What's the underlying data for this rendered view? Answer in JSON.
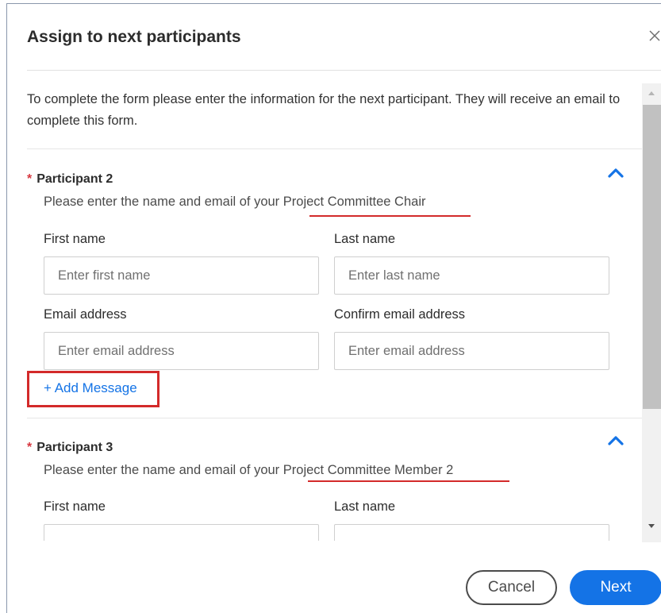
{
  "dialog": {
    "title": "Assign to next participants",
    "close_icon": "close-icon",
    "intro": "To complete the form please enter the information for the next participant. They will receive an email to complete this form."
  },
  "participants": [
    {
      "title": "Participant 2",
      "desc_prefix": "Please enter the name and email of your ",
      "role": "Project Committee Chair",
      "first_name_label": "First name",
      "first_name_placeholder": "Enter first name",
      "last_name_label": "Last name",
      "last_name_placeholder": "Enter last name",
      "email_label": "Email address",
      "email_placeholder": "Enter email address",
      "confirm_email_label": "Confirm email address",
      "confirm_email_placeholder": "Enter email address",
      "add_message": "+ Add Message"
    },
    {
      "title": "Participant 3",
      "desc_prefix": "Please enter the name and email of your ",
      "role": "Project Committee Member 2",
      "first_name_label": "First name",
      "last_name_label": "Last name"
    }
  ],
  "footer": {
    "cancel_label": "Cancel",
    "next_label": "Next"
  },
  "colors": {
    "accent": "#1473e6",
    "required": "#d7373f",
    "annotation": "#d32a2a"
  }
}
